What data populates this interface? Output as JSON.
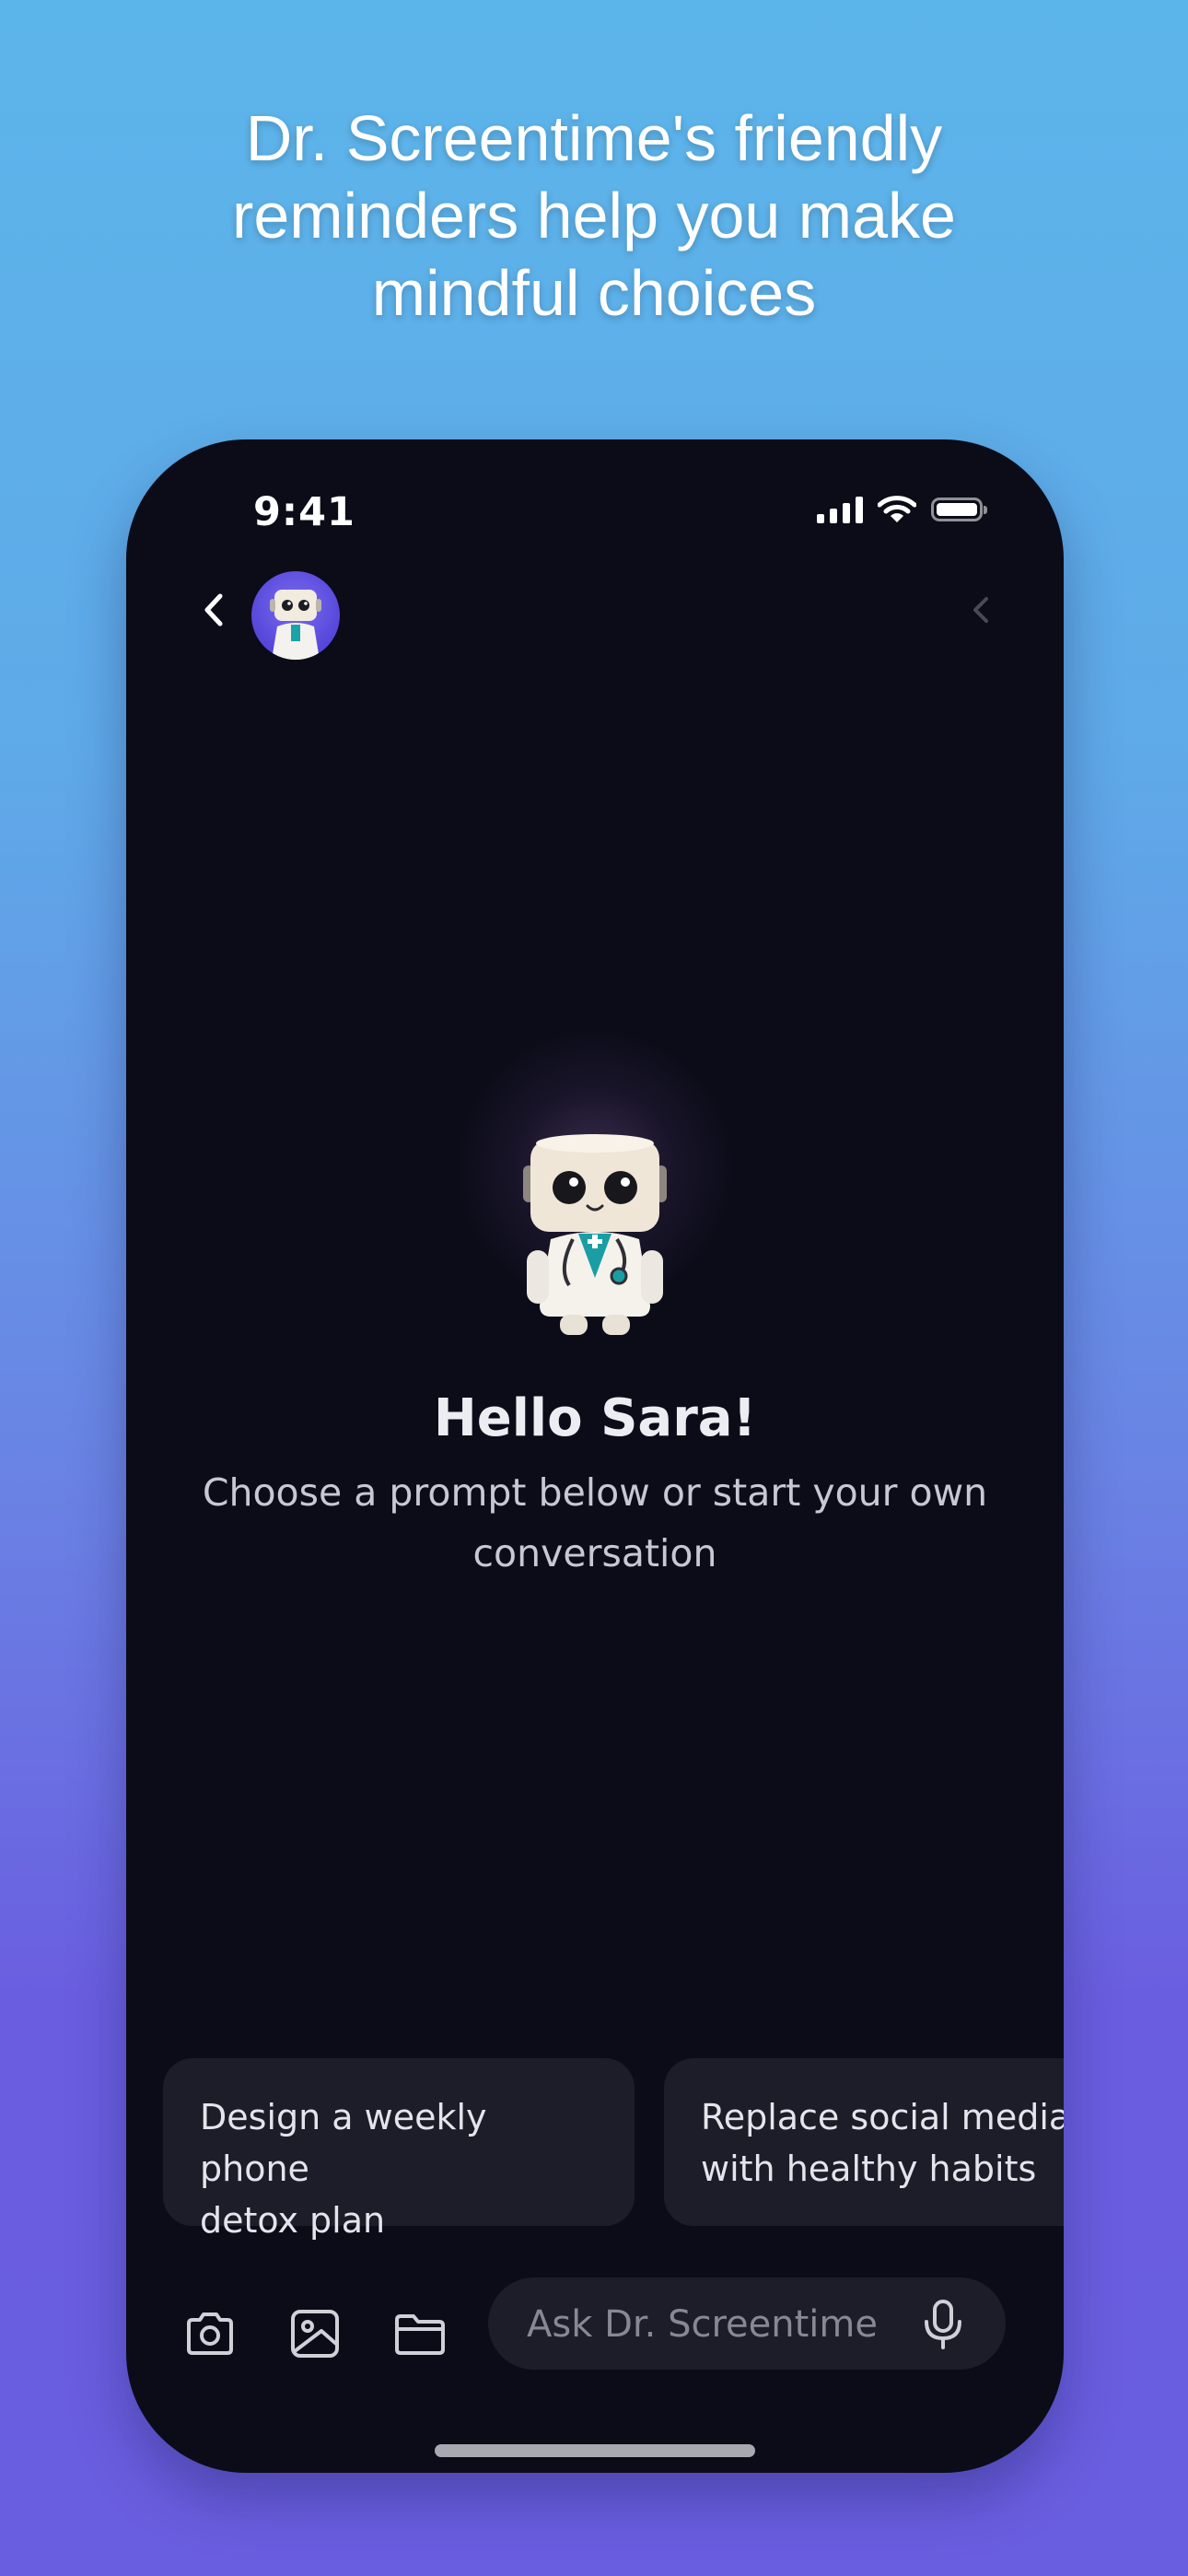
{
  "headline": {
    "line1": "Dr. Screentime's friendly",
    "line2": "reminders help you make",
    "line3": "mindful choices"
  },
  "status_bar": {
    "time": "9:41"
  },
  "chat": {
    "greeting": "Hello Sara!",
    "subtitle_line1": "Choose a prompt below or start your own",
    "subtitle_line2": "conversation"
  },
  "prompts": [
    {
      "line1": "Design a weekly phone",
      "line2": "detox plan"
    },
    {
      "line1": "Replace social media",
      "line2": "with healthy habits"
    }
  ],
  "input": {
    "placeholder": "Ask Dr. Screentime"
  },
  "icons": [
    "chevron-left-icon",
    "avatar",
    "chevron-right-icon",
    "camera-icon",
    "image-icon",
    "folder-icon",
    "microphone-icon"
  ],
  "colors": {
    "background_top": "#5cb5ea",
    "background_bottom": "#6a5ee0",
    "phone_screen": "#0b0c18",
    "chip": "#1c1d28",
    "avatar_bg": "#5646d9"
  }
}
